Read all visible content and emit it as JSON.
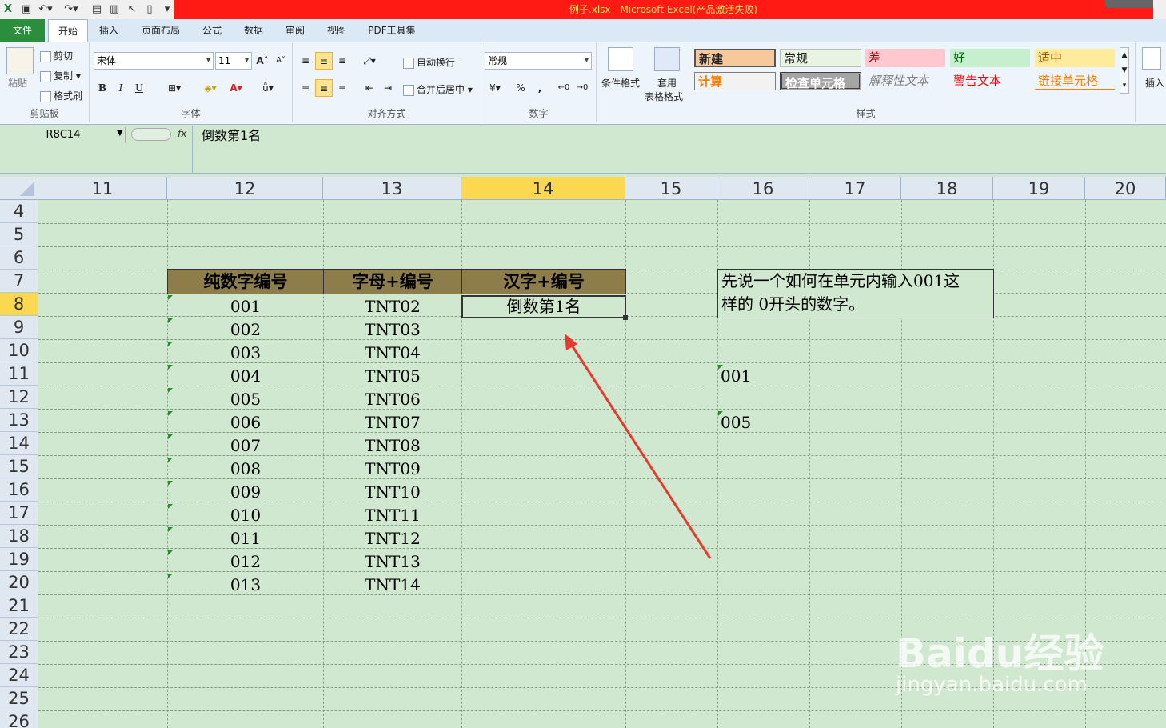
{
  "window": {
    "title": "例子.xlsx - Microsoft Excel(产品激活失败)"
  },
  "tabs": [
    "文件",
    "开始",
    "插入",
    "页面布局",
    "公式",
    "数据",
    "审阅",
    "视图",
    "PDF工具集"
  ],
  "clipboard": {
    "paste": "粘贴",
    "cut": "剪切",
    "copy": "复制",
    "format_painter": "格式刷",
    "group": "剪贴板"
  },
  "font": {
    "name": "宋体",
    "size": "11",
    "bold": "B",
    "italic": "I",
    "underline": "U",
    "group": "字体"
  },
  "alignment": {
    "wrap": "自动换行",
    "merge": "合并后居中",
    "group": "对齐方式"
  },
  "number": {
    "format": "常规",
    "percent": "%",
    "comma": ",",
    "group": "数字"
  },
  "styles": {
    "cond_format": "条件格式",
    "table_format_line1": "套用",
    "table_format_line2": "表格格式",
    "group": "样式",
    "cells": [
      "新建",
      "常规",
      "差",
      "好",
      "适中",
      "计算",
      "检查单元格",
      "解释性文本",
      "警告文本",
      "链接单元格"
    ]
  },
  "insert_label": "插入",
  "formula_bar": {
    "name_box": "R8C14",
    "fx": "fx",
    "content": "倒数第1名"
  },
  "columns": [
    "11",
    "12",
    "13",
    "14",
    "15",
    "16",
    "17",
    "18",
    "19",
    "20"
  ],
  "rows": [
    "4",
    "5",
    "6",
    "7",
    "8",
    "9",
    "10",
    "11",
    "12",
    "13",
    "14",
    "15",
    "16",
    "17",
    "18",
    "19",
    "20",
    "21",
    "22",
    "23",
    "24",
    "25",
    "26"
  ],
  "table": {
    "headers": [
      "纯数字编号",
      "字母+编号",
      "汉字+编号"
    ],
    "col12": [
      "001",
      "002",
      "003",
      "004",
      "005",
      "006",
      "007",
      "008",
      "009",
      "010",
      "011",
      "012",
      "013"
    ],
    "col13": [
      "TNT02",
      "TNT03",
      "TNT04",
      "TNT05",
      "TNT06",
      "TNT07",
      "TNT08",
      "TNT09",
      "TNT10",
      "TNT11",
      "TNT12",
      "TNT13",
      "TNT14"
    ],
    "col14_row8": "倒数第1名"
  },
  "note": {
    "line1": "先说一个如何在单元内输入001这",
    "line2": "样的 0开头的数字。"
  },
  "col16_values": {
    "r11": "001",
    "r13": "005"
  },
  "watermark": {
    "brand": "Baidu经验",
    "url": "jingyan.baidu.com"
  },
  "colors": {
    "header_fill": "#8c7d4a",
    "sheet_bg": "#cfe8cf",
    "selected_header": "#fbd84f",
    "arrow": "#e8392d"
  }
}
